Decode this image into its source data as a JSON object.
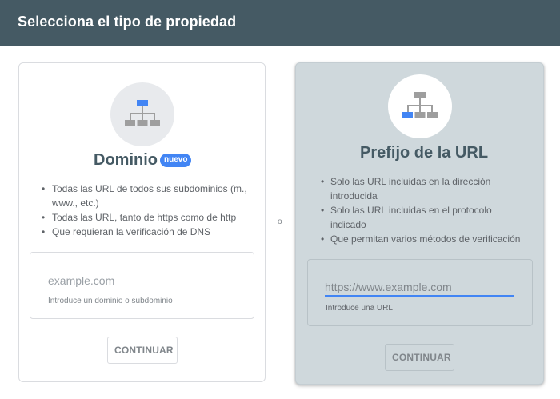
{
  "header": {
    "title": "Selecciona el tipo de propiedad"
  },
  "or_label": "o",
  "domain_card": {
    "icon": "sitemap-icon",
    "title": "Dominio",
    "badge": "nuevo",
    "features": [
      "Todas las URL de todos sus subdominios (m., www., etc.)",
      "Todas las URL, tanto de https como de http",
      "Que requieran la verificación de DNS"
    ],
    "input": {
      "placeholder": "example.com",
      "value": ""
    },
    "helper": "Introduce un dominio o subdominio",
    "button": "CONTINUAR"
  },
  "url_card": {
    "icon": "sitemap-icon",
    "title": "Prefijo de la URL",
    "features": [
      "Solo las URL incluidas en la dirección introducida",
      "Solo las URL incluidas en el protocolo indicado",
      "Que permitan varios métodos de verificación"
    ],
    "input": {
      "placeholder": "https://www.example.com",
      "value": ""
    },
    "helper": "Introduce una URL",
    "button": "CONTINUAR"
  },
  "colors": {
    "header_bg": "#455a64",
    "accent": "#4285f4",
    "selected_card_bg": "#cfd8dc"
  }
}
